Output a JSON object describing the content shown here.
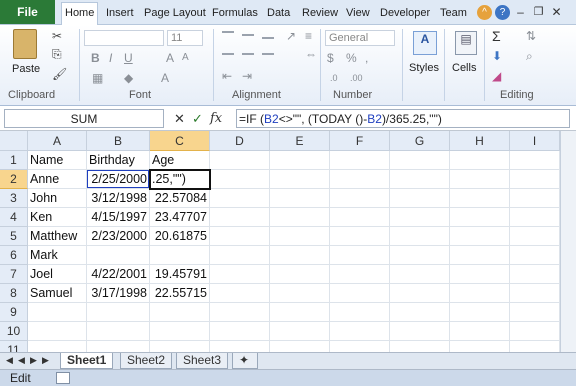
{
  "ribbon_tabs": [
    "Home",
    "Insert",
    "Page Layout",
    "Formulas",
    "Data",
    "Review",
    "View",
    "Developer",
    "Team"
  ],
  "file_tab": "File",
  "ribbon": {
    "paste_label": "Paste",
    "font_size": "11",
    "number_format": "General",
    "styles_label": "Styles",
    "cells_label": "Cells",
    "groups": [
      "Clipboard",
      "Font",
      "Alignment",
      "Number",
      "Editing"
    ]
  },
  "formula_bar": {
    "name_box": "SUM",
    "fx": "fx",
    "formula_parts": [
      "=IF (",
      "B2",
      "<>\"\", (TODAY ()-",
      "B2",
      ")/365.25,\"\")"
    ]
  },
  "columns": [
    "A",
    "B",
    "C",
    "D",
    "E",
    "F",
    "G",
    "H",
    "I"
  ],
  "rows": [
    "1",
    "2",
    "3",
    "4",
    "5",
    "6",
    "7",
    "8",
    "9",
    "10",
    "11"
  ],
  "cells": {
    "A1": "Name",
    "B1": "Birthday",
    "C1": "Age",
    "A2": "Anne",
    "B2": "2/25/2000",
    "C2": ".25,\"\")",
    "A3": "John",
    "B3": "3/12/1998",
    "C3": "22.57084",
    "A4": "Ken",
    "B4": "4/15/1997",
    "C4": "23.47707",
    "A5": "Matthew",
    "B5": "2/23/2000",
    "C5": "20.61875",
    "A6": "Mark",
    "A7": "Joel",
    "B7": "4/22/2001",
    "C7": "19.45791",
    "A8": "Samuel",
    "B8": "3/17/1998",
    "C8": "22.55715"
  },
  "sheet_tabs": [
    "Sheet1",
    "Sheet2",
    "Sheet3"
  ],
  "status": "Edit",
  "colors": {
    "file_green": "#2b7a37",
    "header_sel": "#f8d58e",
    "ref_blue": "#1f3fbf"
  }
}
